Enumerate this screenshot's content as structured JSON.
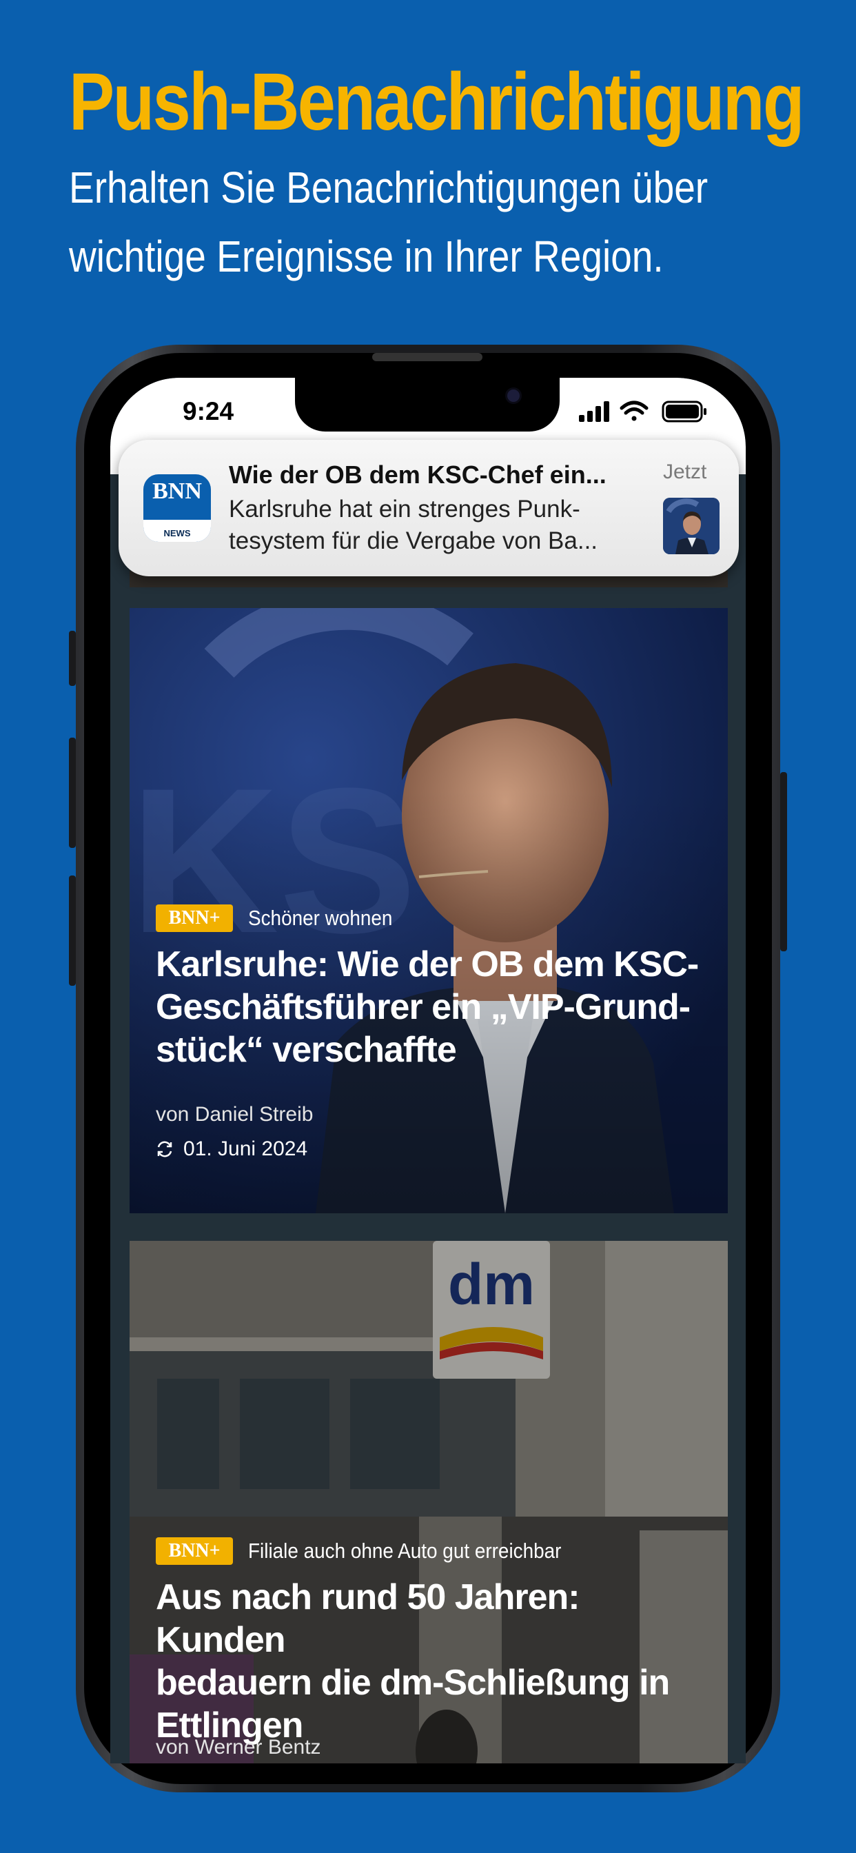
{
  "promo": {
    "title": "Push-Benachrichtigung",
    "subtitle": "Erhalten Sie Benachrichtigungen über wichtige Ereignisse in Ihrer Region."
  },
  "status_bar": {
    "time": "9:24",
    "icons": [
      "signal-icon",
      "wifi-icon",
      "battery-icon"
    ]
  },
  "notification": {
    "app_icon_brand": "BNN",
    "app_icon_sub": "NEWS",
    "title": "Wie der OB dem KSC-Chef ein...",
    "body_line1": "Karlsruhe hat ein strenges Punk-",
    "body_line2": "tesystem für die Vergabe von Ba...",
    "time": "Jetzt"
  },
  "articles": [
    {
      "badge": "BNN+",
      "kicker": "Schöner wohnen",
      "headline_line1": "Karlsruhe: Wie der OB dem KSC-",
      "headline_line2": "Geschäftsführer ein „VIP-Grund-",
      "headline_line3": "stück“ verschaffte",
      "author": "von Daniel Streib",
      "date": "01. Juni 2024"
    },
    {
      "badge": "BNN+",
      "kicker": "Filiale auch ohne Auto gut erreichbar",
      "headline_line1": "Aus nach rund 50 Jahren: Kunden",
      "headline_line2": "bedauern die dm-Schließung in",
      "headline_line3": "Ettlingen",
      "author": "von Werner Bentz",
      "store_sign": "dm"
    }
  ],
  "colors": {
    "background": "#0a5fae",
    "title_accent": "#f7b400",
    "badge": "#f2b100",
    "feed_background": "#223039"
  }
}
